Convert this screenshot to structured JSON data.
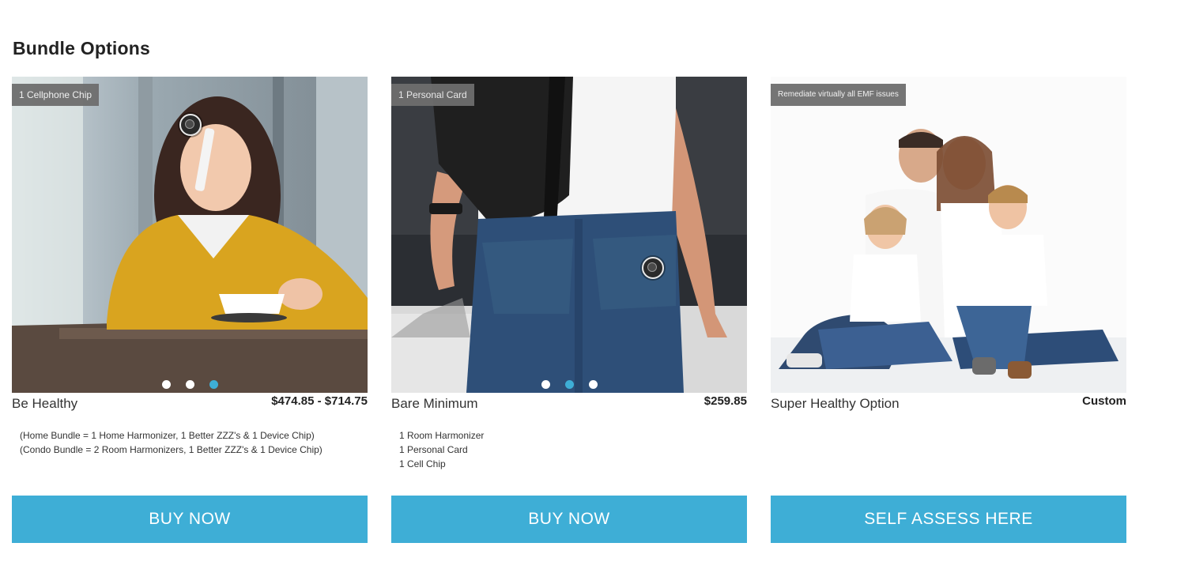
{
  "section": {
    "title": "Bundle Options"
  },
  "colors": {
    "accent": "#3eaed6",
    "tag_bg": "#6e6e6e",
    "text": "#222222"
  },
  "cards": [
    {
      "tag": "1 Cellphone Chip",
      "image": "woman-on-phone-at-cafe",
      "name": "Be Healthy",
      "price": "$474.85 - $714.75",
      "desc": [
        "(Home Bundle = 1 Home Harmonizer, 1 Better ZZZ's & 1 Device Chip)",
        "(Condo Bundle = 2 Room Harmonizers, 1 Better ZZZ's & 1 Device Chip)"
      ],
      "button": "BUY NOW",
      "active_slide": 3
    },
    {
      "tag": "1 Personal Card",
      "image": "person-in-jeans-with-backpack",
      "name": "Bare Minimum",
      "price": "$259.85",
      "desc": [
        "1 Room Harmonizer",
        "1 Personal Card",
        "1 Cell Chip"
      ],
      "button": "BUY NOW",
      "active_slide": 2
    },
    {
      "tag": "Remediate virtually all EMF issues",
      "image": "family-sitting-on-floor",
      "name": "Super Healthy Option",
      "price": "Custom",
      "desc": [],
      "button": "SELF ASSESS HERE"
    }
  ]
}
